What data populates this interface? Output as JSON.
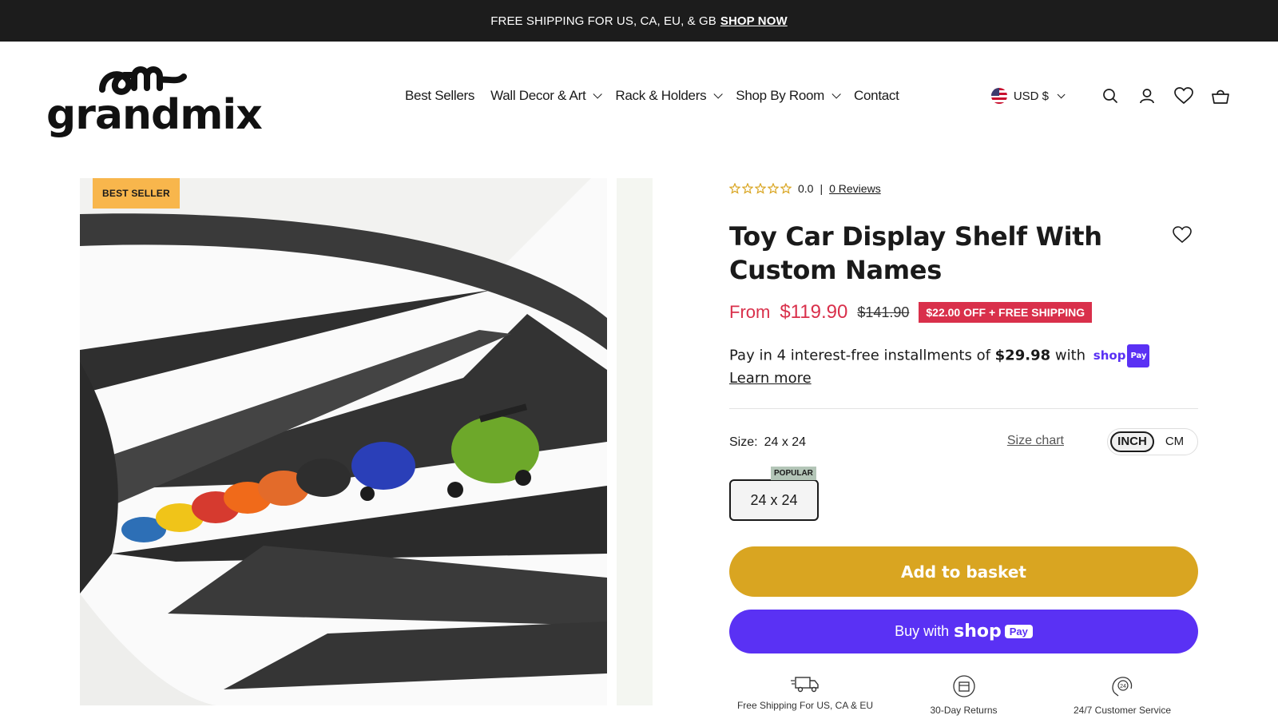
{
  "announcement": {
    "text": "FREE SHIPPING FOR US, CA, EU, & GB",
    "link": "SHOP NOW"
  },
  "brand": {
    "logo_text": "grandmix"
  },
  "nav": {
    "items": [
      {
        "label": "Best Sellers",
        "has_dropdown": false
      },
      {
        "label": "Wall Decor & Art",
        "has_dropdown": true
      },
      {
        "label": "Rack & Holders",
        "has_dropdown": true
      },
      {
        "label": "Shop By Room",
        "has_dropdown": true
      },
      {
        "label": "Contact",
        "has_dropdown": false
      }
    ]
  },
  "header_right": {
    "currency": "USD $",
    "icons": [
      "search-icon",
      "account-icon",
      "wishlist-icon",
      "cart-icon"
    ]
  },
  "gallery": {
    "badge": "BEST SELLER",
    "image_alt": "Toy cars on black wall display shelf"
  },
  "product": {
    "rating_value": "0.0",
    "reviews_link": "0 Reviews",
    "title": "Toy Car Display Shelf With Custom Names",
    "price_prefix": "From",
    "price": "$119.90",
    "compare_price": "$141.90",
    "discount_badge": "$22.00 OFF + FREE SHIPPING",
    "installments_prefix": "Pay in 4 interest-free installments of",
    "installment_amount": "$29.98",
    "installments_suffix": "with",
    "shoppay_mini": "shop",
    "shoppay_mini_pay": "Pay",
    "learn_more": "Learn more",
    "size_label": "Size:",
    "size_value": "24 x 24",
    "size_chart": "Size chart",
    "units": [
      "INCH",
      "CM"
    ],
    "active_unit": "INCH",
    "variant_badge": "POPULAR",
    "variant_label": "24 x 24",
    "add_to_basket": "Add to basket",
    "buy_with": "Buy with",
    "buy_brand": "shop",
    "buy_pay": "Pay"
  },
  "features": [
    {
      "icon": "delivery-truck-icon",
      "label": "Free Shipping For US, CA & EU"
    },
    {
      "icon": "returns-box-icon",
      "label": "30-Day Returns"
    },
    {
      "icon": "support-24-icon",
      "label": "24/7 Customer Service"
    }
  ],
  "colors": {
    "announcement_bg": "#1c1c1c",
    "sale_red": "#d9304b",
    "basket_gold": "#d9a521",
    "shoppay_purple": "#5a31f4",
    "badge_orange": "#f8b64c",
    "popular_green": "#b3c5b7"
  }
}
